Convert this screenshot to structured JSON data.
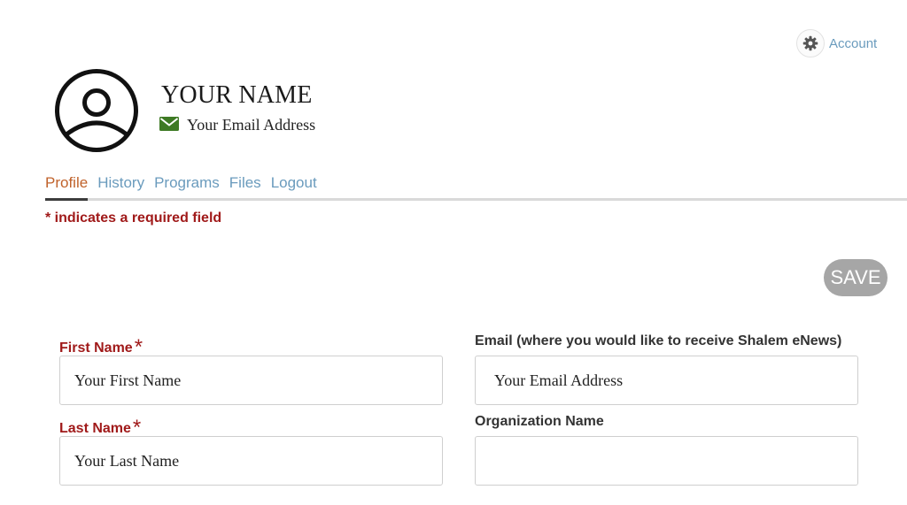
{
  "header": {
    "account_label": "Account",
    "account_icon": "gear-icon",
    "name": "YOUR NAME",
    "email": "Your Email Address",
    "email_icon_color": "#3e7a24",
    "avatar_icon": "user-circle-icon"
  },
  "tabs": [
    {
      "label": "Profile",
      "active": true
    },
    {
      "label": "History",
      "active": false
    },
    {
      "label": "Programs",
      "active": false
    },
    {
      "label": "Files",
      "active": false
    },
    {
      "label": "Logout",
      "active": false
    }
  ],
  "required_note": "* indicates a required field",
  "save_label": "SAVE",
  "form": {
    "first_name": {
      "label": "First Name",
      "required_mark": "*",
      "placeholder": "Your First Name",
      "value": ""
    },
    "last_name": {
      "label": "Last Name",
      "required_mark": "*",
      "placeholder": "Your Last Name",
      "value": ""
    },
    "email": {
      "label": "Email (where you would like to receive Shalem eNews)",
      "placeholder": "Your Email Address",
      "value": ""
    },
    "organization": {
      "label": "Organization Name",
      "placeholder": "",
      "value": ""
    }
  },
  "colors": {
    "link": "#6a9bbd",
    "active_tab": "#c0622b",
    "required": "#a01a1a",
    "save_button": "#a6a6a6"
  }
}
